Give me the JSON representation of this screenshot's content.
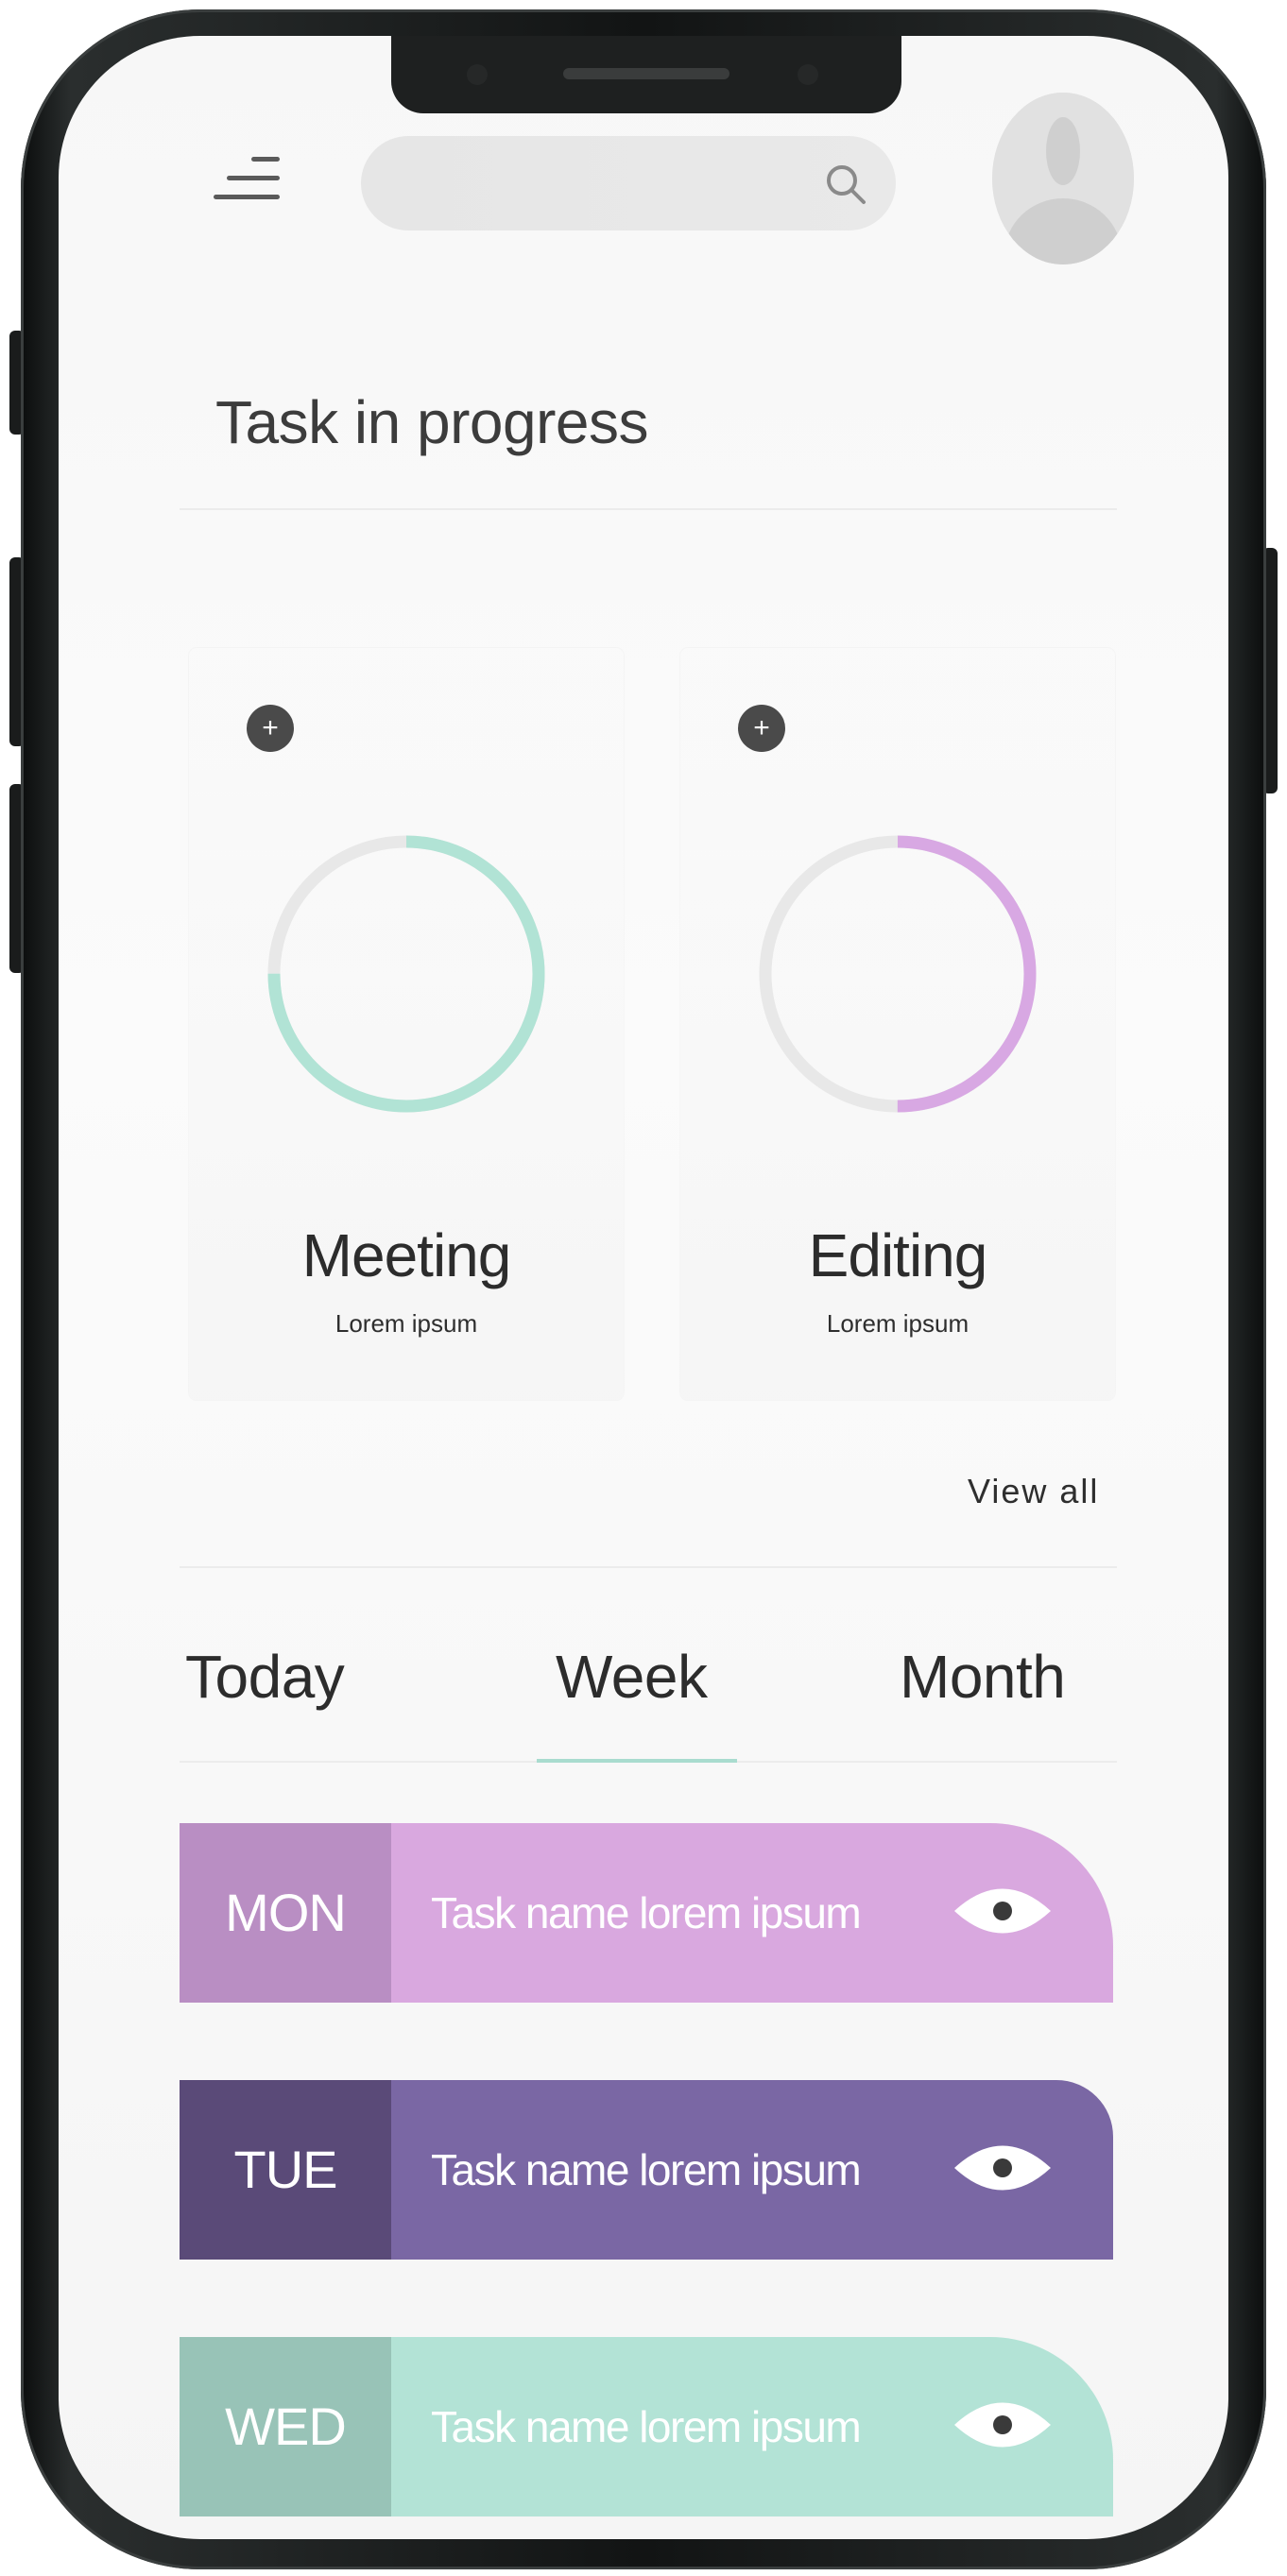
{
  "search": {
    "placeholder": ""
  },
  "section_title": "Task in progress",
  "progress_cards": [
    {
      "title": "Meeting",
      "subtitle": "Lorem ipsum",
      "progress": 0.75,
      "ring_color": "#b1e3d5",
      "track_color": "#e8e8e8",
      "add_symbol": "+"
    },
    {
      "title": "Editing",
      "subtitle": "Lorem ipsum",
      "progress": 0.5,
      "ring_color": "#d8a8e3",
      "track_color": "#e8e8e8",
      "add_symbol": "+"
    }
  ],
  "view_all_label": "View all",
  "tabs": [
    {
      "label": "Today",
      "active": false
    },
    {
      "label": "Week",
      "active": true
    },
    {
      "label": "Month",
      "active": false
    }
  ],
  "tasks": [
    {
      "day": "MON",
      "name": "Task name lorem ipsum",
      "day_color": "#b98ec3",
      "bar_color": "#d9a8df",
      "icon": "eye-icon"
    },
    {
      "day": "TUE",
      "name": "Task name lorem ipsum",
      "day_color": "#5a4a78",
      "bar_color": "#7a67a4",
      "icon": "eye-icon"
    },
    {
      "day": "WED",
      "name": "Task name lorem ipsum",
      "day_color": "#98c3b7",
      "bar_color": "#b3e3d6",
      "icon": "eye-icon"
    }
  ],
  "colors": {
    "accent_tab_underline": "#a9dccf",
    "badge": "#4a4a4a",
    "text_dark": "#2c2c2c"
  }
}
